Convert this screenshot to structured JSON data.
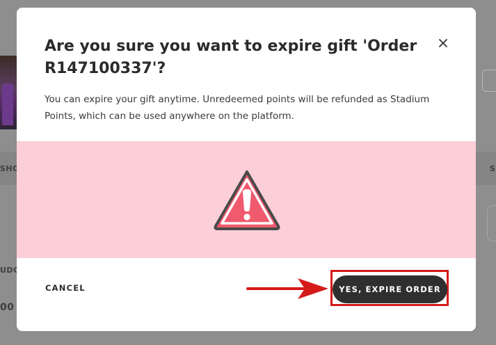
{
  "dialog": {
    "title": "Are you sure you want to expire gift 'Order R147100337'?",
    "description": "You can expire your gift anytime. Unredeemed points will be refunded as Stadium Points, which can be used anywhere on the platform.",
    "cancel_label": "CANCEL",
    "confirm_label": "YES, EXPIRE ORDER",
    "close_icon": "close-icon",
    "warning_icon": "warning-triangle-icon"
  },
  "background": {
    "left_tab_fragment": "SHO",
    "right_tab_fragment": "S",
    "left_label_fragment": "UDG",
    "left_value_fragment": "00"
  },
  "colors": {
    "warning_panel": "#fccfd8",
    "warning_icon_fill": "#f05a6e",
    "confirm_button": "#2f2f2f",
    "annotation_red": "#d51a1a"
  }
}
